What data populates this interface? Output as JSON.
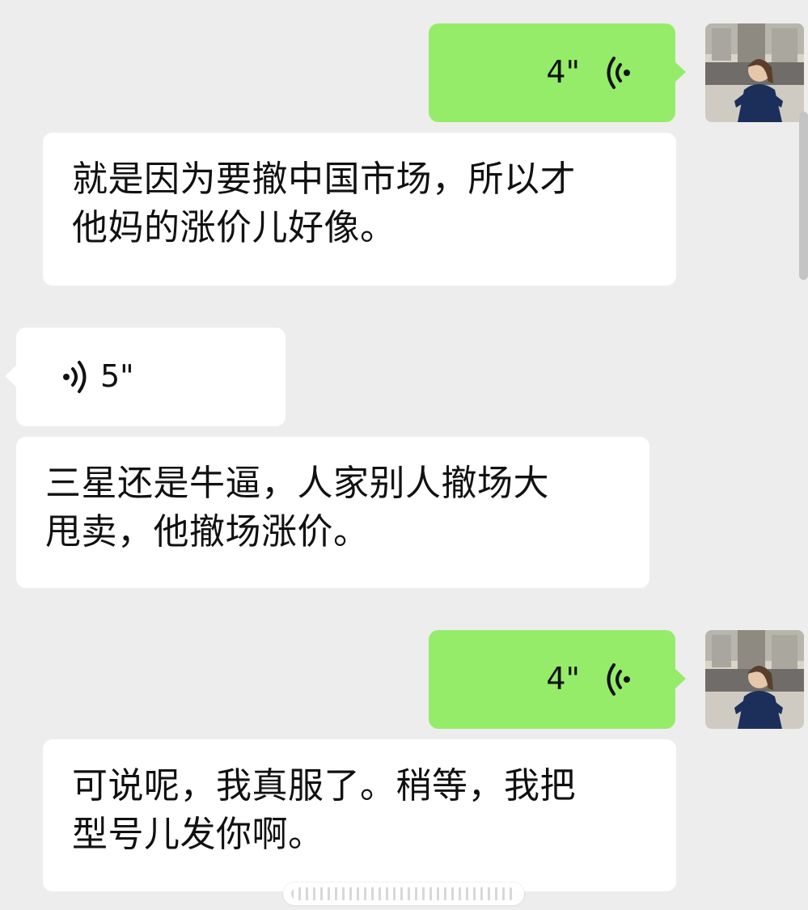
{
  "messages": [
    {
      "type": "voice",
      "direction": "outgoing",
      "duration": "4\""
    },
    {
      "type": "transcript",
      "text": "就是因为要撤中国市场，所以才\n他妈的涨价儿好像。"
    },
    {
      "type": "voice",
      "direction": "incoming",
      "duration": "5\""
    },
    {
      "type": "transcript",
      "text": "三星还是牛逼，人家别人撤场大\n甩卖，他撤场涨价。"
    },
    {
      "type": "voice",
      "direction": "outgoing",
      "duration": "4\""
    },
    {
      "type": "transcript",
      "text": "可说呢，我真服了。稍等，我把\n型号儿发你啊。"
    }
  ],
  "colors": {
    "background": "#ededed",
    "outgoing_bubble": "#95ec69",
    "incoming_bubble": "#ffffff"
  },
  "icons": {
    "voice_outgoing": "voice-wave-icon",
    "voice_incoming": "voice-wave-icon",
    "avatar": "user-avatar"
  }
}
